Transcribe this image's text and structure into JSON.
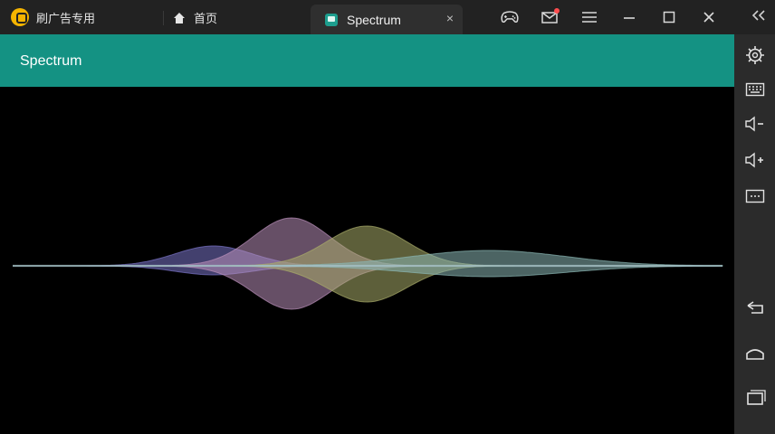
{
  "window": {
    "brand_label": "刷广告专用",
    "home_label": "首页",
    "active_tab_label": "Spectrum",
    "tab_close_glyph": "×"
  },
  "toolbar": {
    "icons": [
      "gamepad-icon",
      "mail-icon",
      "menu-icon",
      "minimize-icon",
      "maximize-icon",
      "close-icon"
    ],
    "mail_dot_color": "#ff4d4f"
  },
  "app": {
    "title": "Spectrum",
    "appbar_color": "#149283",
    "background": "#000000"
  },
  "sidebar": {
    "icons": [
      "settings-icon",
      "keyboard-icon",
      "volume-down-icon",
      "volume-up-icon",
      "more-icon",
      "back-icon",
      "home-icon",
      "recent-apps-icon"
    ]
  },
  "visualizer": {
    "waves": [
      {
        "name": "",
        "color": "#7a74c8"
      },
      {
        "name": "",
        "color": "#b98fb9"
      },
      {
        "name": "",
        "color": "#a9ad69"
      },
      {
        "name": "",
        "color": "#8ab7b4"
      }
    ]
  }
}
